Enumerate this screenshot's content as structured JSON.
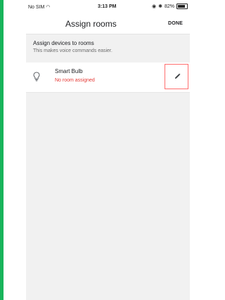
{
  "status_bar": {
    "carrier": "No SIM",
    "time": "3:13 PM",
    "battery": "82%"
  },
  "header": {
    "title": "Assign rooms",
    "done_label": "DONE"
  },
  "intro": {
    "title": "Assign devices to rooms",
    "subtitle": "This makes voice commands easier."
  },
  "devices": [
    {
      "name": "Smart Bulb",
      "room": "No room assigned",
      "icon": "lightbulb-icon"
    }
  ],
  "colors": {
    "unassigned_text": "#e53935",
    "highlight_box": "#ff6f6f",
    "left_strip": "#18b45a"
  }
}
